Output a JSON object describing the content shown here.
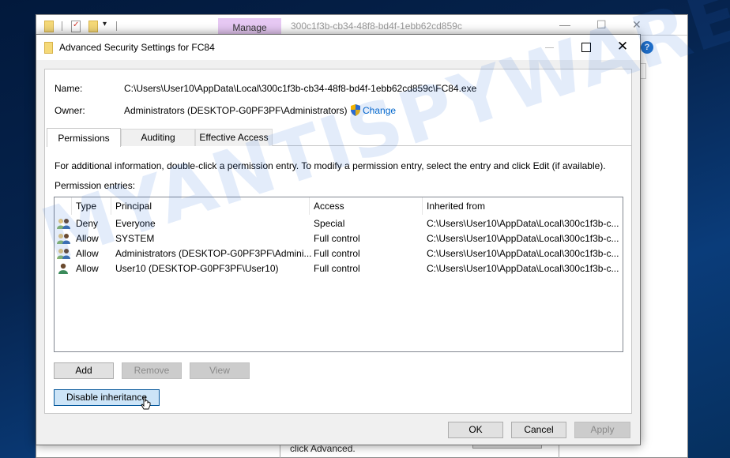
{
  "background_window": {
    "manage_tab": "Manage",
    "title": "300c1f3b-cb34-48f8-bd4f-1ebb62cd859c",
    "behind_text": "click Advanced."
  },
  "dialog": {
    "title": "Advanced Security Settings for FC84",
    "name_label": "Name:",
    "name_value": "C:\\Users\\User10\\AppData\\Local\\300c1f3b-cb34-48f8-bd4f-1ebb62cd859c\\FC84.exe",
    "owner_label": "Owner:",
    "owner_value": "Administrators (DESKTOP-G0PF3PF\\Administrators)",
    "change_link": "Change",
    "tabs": [
      {
        "label": "Permissions",
        "active": true
      },
      {
        "label": "Auditing",
        "active": false
      },
      {
        "label": "Effective Access",
        "active": false
      }
    ],
    "info_text": "For additional information, double-click a permission entry. To modify a permission entry, select the entry and click Edit (if available).",
    "entries_label": "Permission entries:",
    "columns": [
      "Type",
      "Principal",
      "Access",
      "Inherited from"
    ],
    "entries": [
      {
        "icon": "group-users-icon",
        "type": "Deny",
        "principal": "Everyone",
        "access": "Special",
        "inherited_from": "C:\\Users\\User10\\AppData\\Local\\300c1f3b-c..."
      },
      {
        "icon": "group-users-icon",
        "type": "Allow",
        "principal": "SYSTEM",
        "access": "Full control",
        "inherited_from": "C:\\Users\\User10\\AppData\\Local\\300c1f3b-c..."
      },
      {
        "icon": "group-users-icon",
        "type": "Allow",
        "principal": "Administrators (DESKTOP-G0PF3PF\\Admini...",
        "access": "Full control",
        "inherited_from": "C:\\Users\\User10\\AppData\\Local\\300c1f3b-c..."
      },
      {
        "icon": "single-user-icon",
        "type": "Allow",
        "principal": "User10 (DESKTOP-G0PF3PF\\User10)",
        "access": "Full control",
        "inherited_from": "C:\\Users\\User10\\AppData\\Local\\300c1f3b-c..."
      }
    ],
    "buttons": {
      "add": "Add",
      "remove": "Remove",
      "view": "View",
      "disable_inheritance": "Disable inheritance",
      "ok": "OK",
      "cancel": "Cancel",
      "apply": "Apply"
    }
  },
  "watermark": "MYANTISPYWARE.COM"
}
